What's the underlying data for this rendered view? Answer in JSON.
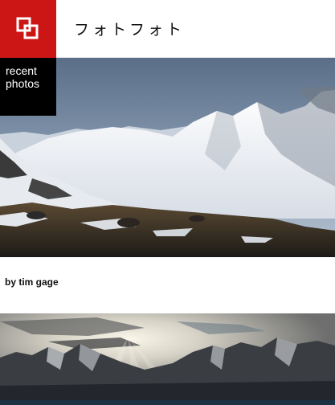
{
  "header": {
    "title": "フォトフォト",
    "logo_icon": "overlapping-squares-icon",
    "colors": {
      "logo_bg": "#cc1616"
    }
  },
  "sidebar": {
    "recent_label_line1": "recent",
    "recent_label_line2": "photos"
  },
  "feed": {
    "photos": [
      {
        "subject": "snow-covered mountain range",
        "caption": "by tim gage"
      },
      {
        "subject": "sunbeams over rocky peaks"
      }
    ]
  }
}
